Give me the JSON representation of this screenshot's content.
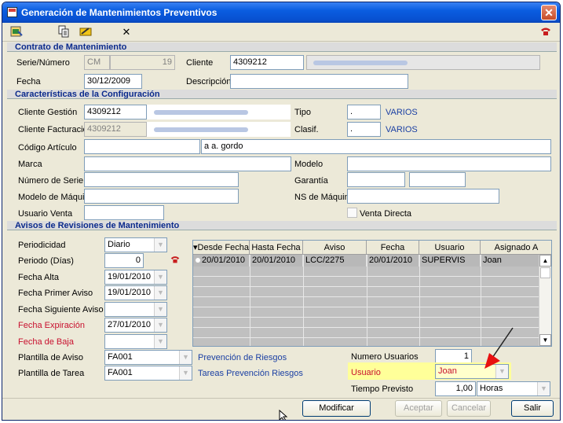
{
  "window": {
    "title": "Generación de Mantenimientos Preventivos"
  },
  "contrato": {
    "header": "Contrato de Mantenimiento",
    "serie_label": "Serie/Número",
    "serie_prefix": "CM",
    "serie_number": "19",
    "cliente_label": "Cliente",
    "cliente_code": "4309212",
    "fecha_label": "Fecha",
    "fecha_value": "30/12/2009",
    "descripcion_label": "Descripción",
    "descripcion_value": ""
  },
  "config": {
    "header": "Características de la Configuración",
    "cliente_gestion_label": "Cliente Gestión",
    "cliente_gestion_value": "4309212",
    "cliente_facturacion_label": "Cliente Facturación",
    "cliente_facturacion_value": "4309212",
    "tipo_label": "Tipo",
    "tipo_code": ".",
    "tipo_value": "VARIOS",
    "clasif_label": "Clasif.",
    "clasif_code": ".",
    "clasif_value": "VARIOS",
    "codigo_articulo_label": "Código Artículo",
    "codigo_articulo_value": "",
    "articulo_desc": "a a. gordo",
    "marca_label": "Marca",
    "modelo_label": "Modelo",
    "numero_serie_label": "Número de Serie",
    "garantia_label": "Garantía",
    "modelo_maquina_label": "Modelo de Máquina",
    "ns_maquina_label": "NS de Máquina",
    "usuario_venta_label": "Usuario Venta",
    "venta_directa_label": "Venta Directa"
  },
  "avisos": {
    "header": "Avisos de Revisiones de Mantenimiento",
    "periodicidad_label": "Periodicidad",
    "periodicidad_value": "Diario",
    "periodo_label": "Periodo (Días)",
    "periodo_value": "0",
    "fecha_alta_label": "Fecha Alta",
    "fecha_alta_value": "19/01/2010",
    "fecha_primer_aviso_label": "Fecha Primer Aviso",
    "fecha_primer_aviso_value": "19/01/2010",
    "fecha_siguiente_aviso_label": "Fecha Siguiente Aviso",
    "fecha_siguiente_aviso_value": "",
    "fecha_expiracion_label": "Fecha Expiración",
    "fecha_expiracion_value": "27/01/2010",
    "fecha_baja_label": "Fecha de Baja",
    "fecha_baja_value": "",
    "plantilla_aviso_label": "Plantilla de Aviso",
    "plantilla_aviso_code": "FA001",
    "plantilla_aviso_desc": "Prevención de Riesgos",
    "plantilla_tarea_label": "Plantilla de Tarea",
    "plantilla_tarea_code": "FA001",
    "plantilla_tarea_desc": "Tareas Prevención Riesgos",
    "numero_usuarios_label": "Numero Usuarios",
    "numero_usuarios_value": "1",
    "usuario_label": "Usuario",
    "usuario_value": "Joan",
    "tiempo_previsto_label": "Tiempo Previsto",
    "tiempo_previsto_value": "1,00",
    "tiempo_unit": "Horas"
  },
  "table": {
    "columns": [
      "Desde Fecha",
      "Hasta Fecha",
      "Aviso",
      "Fecha",
      "Usuario",
      "Asignado A"
    ],
    "sort_indicator": "▾",
    "rows": [
      [
        "20/01/2010",
        "20/01/2010",
        "LCC/2275",
        "20/01/2010",
        "SUPERVIS",
        "Joan"
      ]
    ]
  },
  "buttons": {
    "modificar": "Modificar",
    "aceptar": "Aceptar",
    "cancelar": "Cancelar",
    "salir": "Salir"
  },
  "colors": {
    "section_text": "#0b2a8c",
    "highlight": "#ffff99",
    "annotation_arrow": "#e81010"
  }
}
